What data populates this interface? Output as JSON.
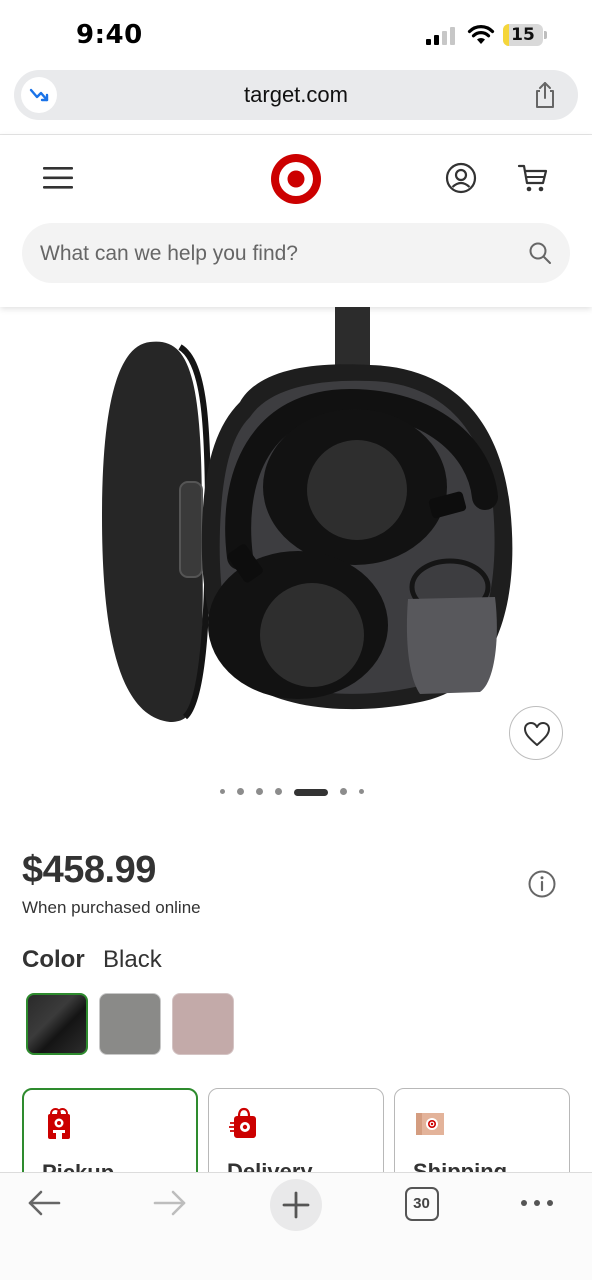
{
  "status_bar": {
    "time": "9:40",
    "battery_level": "15",
    "battery_fraction": 0.15
  },
  "browser": {
    "url": "target.com",
    "tab_count": "30"
  },
  "header": {
    "search_placeholder": "What can we help you find?"
  },
  "product": {
    "image_icon": "headphones-in-case-photo",
    "carousel": {
      "count": 7,
      "active_index": 4
    },
    "price": "$458.99",
    "price_note": "When purchased online",
    "color_label": "Color",
    "color_value": "Black",
    "swatches": [
      {
        "name": "Black",
        "color": "#222222",
        "selected": true
      },
      {
        "name": "Gray",
        "color": "#8a8a88",
        "selected": false
      },
      {
        "name": "Pink",
        "color": "#c3aaa9",
        "selected": false
      }
    ]
  },
  "fulfillment": [
    {
      "label": "Pickup",
      "icon": "pickup-store-icon",
      "selected": true
    },
    {
      "label": "Delivery",
      "icon": "delivery-bag-icon",
      "selected": false
    },
    {
      "label": "Shipping",
      "icon": "shipping-box-icon",
      "selected": false
    }
  ],
  "colors": {
    "brand_red": "#cc0000",
    "selected_green": "#2e8b2e"
  }
}
